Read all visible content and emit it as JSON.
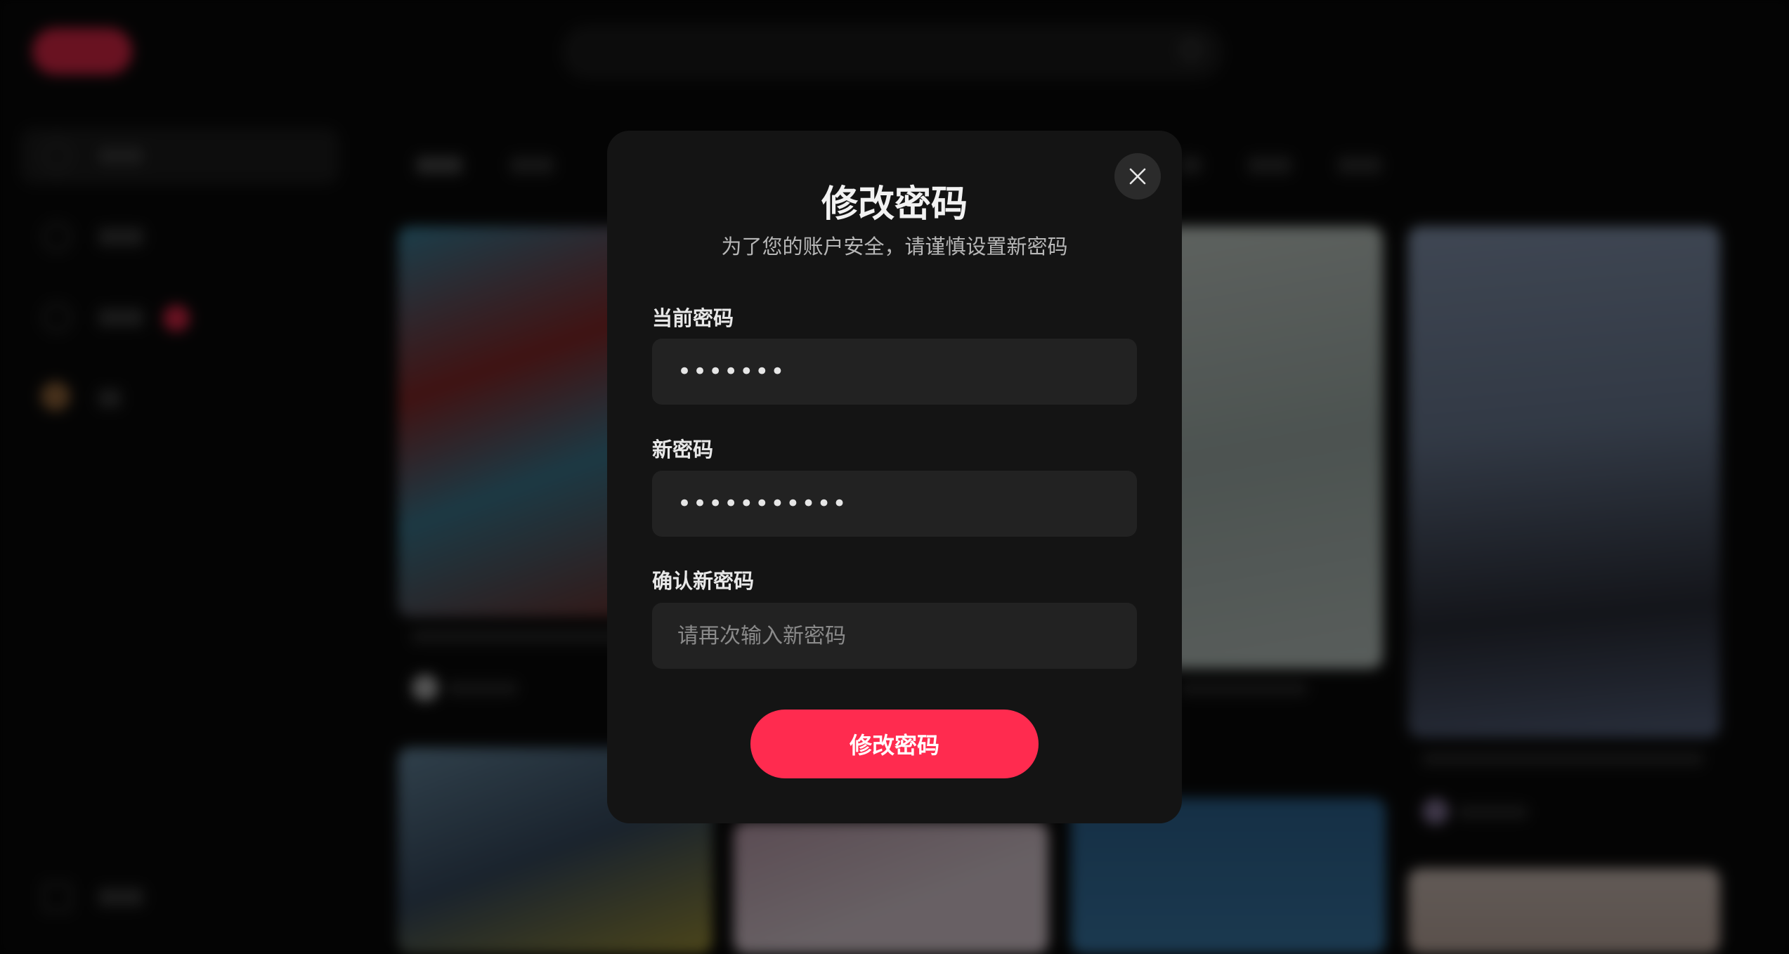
{
  "modal": {
    "title": "修改密码",
    "subtitle": "为了您的账户安全，请谨慎设置新密码",
    "close_icon": "close-icon",
    "fields": {
      "current": {
        "label": "当前密码",
        "value": "•••••••",
        "placeholder": ""
      },
      "new": {
        "label": "新密码",
        "value": "•••••••••••",
        "placeholder": ""
      },
      "confirm": {
        "label": "确认新密码",
        "value": "",
        "placeholder": "请再次输入新密码"
      }
    },
    "submit_label": "修改密码"
  },
  "colors": {
    "accent": "#ff2b4f",
    "modal_bg": "#141414",
    "input_bg": "#222222",
    "backdrop": "#050505"
  }
}
